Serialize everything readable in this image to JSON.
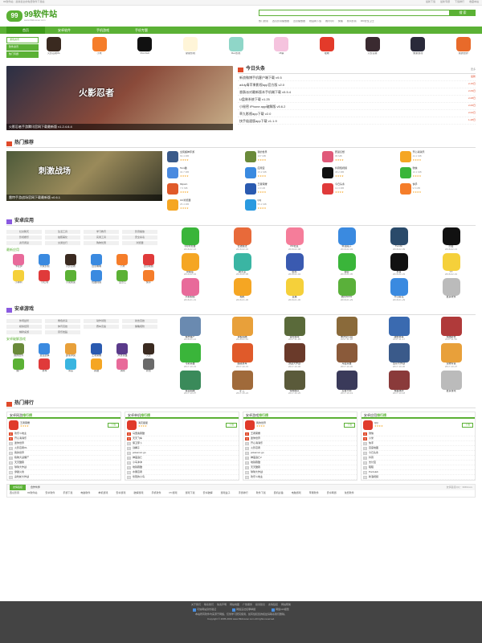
{
  "top": {
    "left": "99软件站：最新最全的免费软件下载站",
    "links": [
      "最新下载",
      "最新专题",
      "下载排行",
      "收藏本站"
    ]
  },
  "header": {
    "brand": "99软件站",
    "domain": "www.99downer.com",
    "slogan": "",
    "search_placeholder": "",
    "search_btn": "搜 索",
    "hot": [
      "热门搜索",
      "西瓜影音播放器",
      "迅雷播放器",
      "校园网下载",
      "腾讯QQ",
      "快播",
      "暴风影音",
      "360安全卫士"
    ]
  },
  "nav": [
    "首页",
    "安卓软件",
    "手机游戏",
    "手机专题"
  ],
  "cats": [
    "游戏资讯",
    "软件资讯",
    "热门专题"
  ],
  "strip": [
    {
      "n": "火影忍者OL",
      "c": "#3a2a20"
    },
    {
      "n": "小米",
      "c": "#f57d2a"
    },
    {
      "n": "Pornhub",
      "c": "#111"
    },
    {
      "n": "摩摩影视",
      "c": "#fff5d8"
    },
    {
      "n": "Rec影视",
      "c": "#8fd6c8"
    },
    {
      "n": "18禁",
      "c": "#f5c3de"
    },
    {
      "n": "暧昧",
      "c": "#e33a2a"
    },
    {
      "n": "火影忍者",
      "c": "#3a2a30"
    },
    {
      "n": "像素游戏",
      "c": "#2a2a3a"
    },
    {
      "n": "我的世界",
      "c": "#e86a2a"
    }
  ],
  "banner": {
    "caption": "火影忍者手游腾讯官网下载最新版 v1.2.4.6.4",
    "title": "火影忍者",
    "news_title": "今日头条",
    "more": "更多",
    "news": [
      {
        "t": "新浪微博手机客户端下载 v9.5",
        "d": "最新"
      },
      {
        "t": "a4dy青苹果影视app官方版 v2.0",
        "d": "2-15日"
      },
      {
        "t": "香肠派对最新版本手机端下载 v5.5.4",
        "d": "2-09日"
      },
      {
        "t": "U盘装系统下载 v1.25",
        "d": "2-08日"
      },
      {
        "t": "小秘密 iPhone app破解版 v5.6.2",
        "d": "2-06日"
      },
      {
        "t": "草九影视app下载 v2.0",
        "d": "2-02日"
      },
      {
        "t": "快手极速版app下载 v1.1.9",
        "d": "1-28日"
      }
    ]
  },
  "hot": {
    "title": "热门推荐",
    "caption": "雷特手游战场官网下载最新版 v0.6.1",
    "img_title": "刺激战场",
    "items": [
      {
        "n": "全民超神手游",
        "s": "63.4 MB",
        "c": "#3a5a8a"
      },
      {
        "n": "我的世界",
        "s": "107 MB",
        "c": "#6a8a3a"
      },
      {
        "n": "碧蓝幻想",
        "s": "95 MB",
        "c": "#e05a7a"
      },
      {
        "n": "开心消消乐",
        "s": "44.1 MB",
        "c": "#f5a623"
      },
      {
        "n": "Tom猫",
        "s": "34.7 MB",
        "c": "#4a8ae0"
      },
      {
        "n": "应用宝",
        "s": "15.2 MB",
        "c": "#3a8ae0"
      },
      {
        "n": "抖音短视频",
        "s": "38.2 MB",
        "c": "#111"
      },
      {
        "n": "微信",
        "s": "10.1 MB",
        "c": "#3ab53a"
      },
      {
        "n": "91porn",
        "s": "7.6 MB",
        "c": "#e05a2a"
      },
      {
        "n": "王者荣耀",
        "s": "1.9 GB",
        "c": "#2a5ab0"
      },
      {
        "n": "今日头条",
        "s": "12.3 MB",
        "c": "#e03a3a"
      },
      {
        "n": "快手",
        "s": "9.5 MB",
        "c": "#f57d2a"
      },
      {
        "n": "UC浏览器",
        "s": "25.4 MB",
        "c": "#f5a623"
      },
      {
        "n": "QQ",
        "s": "55.2 MB",
        "c": "#2a9ae0"
      }
    ]
  },
  "android": {
    "title": "安卓应用",
    "tags": [
      "社交聊天",
      "生活工具",
      "学习教育",
      "影音播放",
      "影视娱乐",
      "拍照美化",
      "实用工具",
      "安全杀毒",
      "资讯阅读",
      "交通出行",
      "购物优惠",
      "浏览器"
    ],
    "sub": "最新应用",
    "mini": [
      {
        "n": "卡哇伊",
        "c": "#e86a9a"
      },
      {
        "n": "大象影视",
        "c": "#3a8ae0"
      },
      {
        "n": "火影忍者",
        "c": "#3a2a20"
      },
      {
        "n": "迅雷看看",
        "c": "#3a8ae0"
      },
      {
        "n": "小米",
        "c": "#f57d2a"
      },
      {
        "n": "西瓜视频",
        "c": "#e03a3a"
      },
      {
        "n": "小黄鸭",
        "c": "#f5d03a"
      },
      {
        "n": "小红书",
        "c": "#e03a3a"
      },
      {
        "n": "小说阅读",
        "c": "#5bb135"
      },
      {
        "n": "优酷视频",
        "c": "#3a8ae0"
      },
      {
        "n": "爱奇艺",
        "c": "#5bb135"
      },
      {
        "n": "快手",
        "c": "#f57d2a"
      }
    ],
    "grid": [
      {
        "n": "QQ浏览器",
        "d": "2018-02-16",
        "c": "#3ab53a"
      },
      {
        "n": "奇迹魔法",
        "d": "2018-02-16",
        "c": "#e86a3a"
      },
      {
        "n": "PR社区",
        "d": "2018-02-08",
        "c": "#f57d9a"
      },
      {
        "n": "笑话段子",
        "d": "2018-02-03",
        "c": "#3a8ae0"
      },
      {
        "n": "Tumblr",
        "d": "2018-02-09",
        "c": "#2a4a6a"
      },
      {
        "n": "约会",
        "d": "2018-02-13",
        "c": "#111"
      },
      {
        "n": "抑郁症",
        "d": "2018-02-04",
        "c": "#f5a623"
      },
      {
        "n": "聊天宝",
        "d": "2018-02-05",
        "c": "#3ab5a3"
      },
      {
        "n": "脸书",
        "d": "2018-02-04",
        "c": "#3a5ab0"
      },
      {
        "n": "秘密",
        "d": "2018-02-05",
        "c": "#3ab53a"
      },
      {
        "n": "抖音",
        "d": "2018-02-03",
        "c": "#111"
      },
      {
        "n": "YY",
        "d": "2018-02-01",
        "c": "#f5d03a"
      },
      {
        "n": "乐视视频",
        "d": "2018-01-31",
        "c": "#e86a9a"
      },
      {
        "n": "相机",
        "d": "2018-01-30",
        "c": "#f5a623"
      },
      {
        "n": "直播",
        "d": "2018-01-30",
        "c": "#f5d03a"
      },
      {
        "n": "腾讯NOW",
        "d": "2018-01-29",
        "c": "#5ab03a"
      },
      {
        "n": "开心麻花",
        "d": "2018-01-29",
        "c": "#3a8ae0"
      },
      {
        "n": "更多软件",
        "d": "",
        "c": "#bbb"
      }
    ]
  },
  "games": {
    "title": "安卓游戏",
    "tags": [
      "休闲益智",
      "角色扮演",
      "动作冒险",
      "射击竞技",
      "模拟经营",
      "体育竞技",
      "赛车竞速",
      "策略塔防",
      "棋牌桌游",
      "音乐舞蹈"
    ],
    "sub": "安卓破解游戏",
    "mini": [
      {
        "n": "我的世界",
        "c": "#6a8a3a"
      },
      {
        "n": "皇室战争",
        "c": "#3a8ae0"
      },
      {
        "n": "部落冲突",
        "c": "#e8a03a"
      },
      {
        "n": "王者荣耀",
        "c": "#2a5ab0"
      },
      {
        "n": "风暴英雄",
        "c": "#5a3a8a"
      },
      {
        "n": "火影",
        "c": "#3a2a20"
      },
      {
        "n": "僵尸",
        "c": "#5bb135"
      },
      {
        "n": "赛车",
        "c": "#e03a3a"
      },
      {
        "n": "海岛",
        "c": "#3ab5e0"
      },
      {
        "n": "跑酷",
        "c": "#f5a623"
      },
      {
        "n": "消除",
        "c": "#e86a9a"
      },
      {
        "n": "射击",
        "c": "#6a6a6a"
      }
    ],
    "grid": [
      {
        "n": "城市僵尸",
        "d": "2018-01-12",
        "c": "#6a8ab0"
      },
      {
        "n": "滑板跑酷",
        "d": "2018-01-12",
        "c": "#e8a03a"
      },
      {
        "n": "冒险游戏",
        "d": "2017-11-29",
        "c": "#5a6a3a"
      },
      {
        "n": "侏罗纪公园",
        "d": "2017-11-28",
        "c": "#8a6a3a"
      },
      {
        "n": "越野赛车",
        "d": "2017-11-17",
        "c": "#3a6ab0"
      },
      {
        "n": "炫酷射击",
        "d": "2017-11-10",
        "c": "#b03a3a"
      },
      {
        "n": "弓箭英雄",
        "d": "2017-10-31",
        "c": "#3ab53a"
      },
      {
        "n": "超级赛车",
        "d": "2017-10-31",
        "c": "#e05a2a"
      },
      {
        "n": "激战大作战",
        "d": "2017-10-30",
        "c": "#6a3a2a"
      },
      {
        "n": "海盗英雄",
        "d": "2017-10-30",
        "c": "#8a5a3a"
      },
      {
        "n": "生存大作战",
        "d": "2017-10-30",
        "c": "#3a5a8a"
      },
      {
        "n": "宠物传说",
        "d": "2017-10-27",
        "c": "#e8a03a"
      },
      {
        "n": "铁道跑酷",
        "d": "2017-10-27",
        "c": "#3a8a5a"
      },
      {
        "n": "矿工",
        "d": "2017-10-24",
        "c": "#a06a3a"
      },
      {
        "n": "特种部队",
        "d": "2017-10-20",
        "c": "#5a5a3a"
      },
      {
        "n": "忍者大师",
        "d": "2017-10-19",
        "c": "#3a3a5a"
      },
      {
        "n": "城堡攻防",
        "d": "2017-10-18",
        "c": "#8a3a3a"
      },
      {
        "n": "更多游戏",
        "d": "",
        "c": "#bbb"
      }
    ]
  },
  "ranks": {
    "title": "热门排行",
    "boxes": [
      {
        "t": "安卓网游",
        "b": "排行榜",
        "first": "王者荣耀",
        "items": [
          "欢乐斗地主",
          "开心消消乐",
          "迷你世界",
          "火影忍者OL",
          "我的世界",
          "植物大战僵尸",
          "天天酷跑",
          "球球大作战",
          "穿越火线",
          "贪吃蛇大作战"
        ]
      },
      {
        "t": "安卓单机",
        "b": "排行榜",
        "first": "消灭星星",
        "items": [
          "马里奥跑酷",
          "天天飞车",
          "保卫萝卜",
          "割绳子",
          "pokemon go",
          "神庙逃亡",
          "小鸟冲冲",
          "地铁跑酷",
          "水果忍者",
          "愤怒的小鸟"
        ]
      },
      {
        "t": "安卓游戏",
        "b": "排行榜",
        "first": "我的世界",
        "items": [
          "王者荣耀",
          "迷你世界",
          "开心消消乐",
          "火影忍者",
          "pokemon go",
          "神庙逃亡2",
          "地铁跑酷",
          "天天酷跑",
          "球球大作战",
          "欢乐斗地主"
        ]
      },
      {
        "t": "安卓应用",
        "b": "排行榜",
        "first": "QQ",
        "items": [
          "微信",
          "小米",
          "快手",
          "百度地图",
          "今日头条",
          "抖音",
          "支付宝",
          "陌陌",
          "PornHub",
          "新浪视频"
        ]
      }
    ]
  },
  "friend": {
    "tab": "友情链接",
    "tab2": "合作伙伴",
    "right": "友情链接QQ：3040xxxx",
    "links": [
      "西瓜影音",
      "99软件站",
      "安卓软件",
      "手游下载",
      "电脑软件",
      "单机游戏",
      "安卓游戏",
      "破解游戏",
      "手机软件",
      "PC游戏",
      "游戏下载",
      "安卓破解",
      "游戏盒子",
      "手游排行",
      "软件下载",
      "装机必备",
      "电脑游戏",
      "苹果软件",
      "安卓网游",
      "免费软件"
    ]
  },
  "footer": {
    "links": [
      "关于我们",
      "联系我们",
      "免责声明",
      "网站地图",
      "广告服务",
      "投诉建议",
      "友情链接",
      "网站帮助"
    ],
    "safe": [
      "可信网站身份验证",
      "网络违法犯罪举报",
      "网络110报警"
    ],
    "copy": "本站所有软件均来源于网络，仅供学习研究使用，如有侵犯您的权益请联系我们删除。",
    "copy2": "Copyright © 2005-2019 www.99downer.com All rights reserved."
  }
}
